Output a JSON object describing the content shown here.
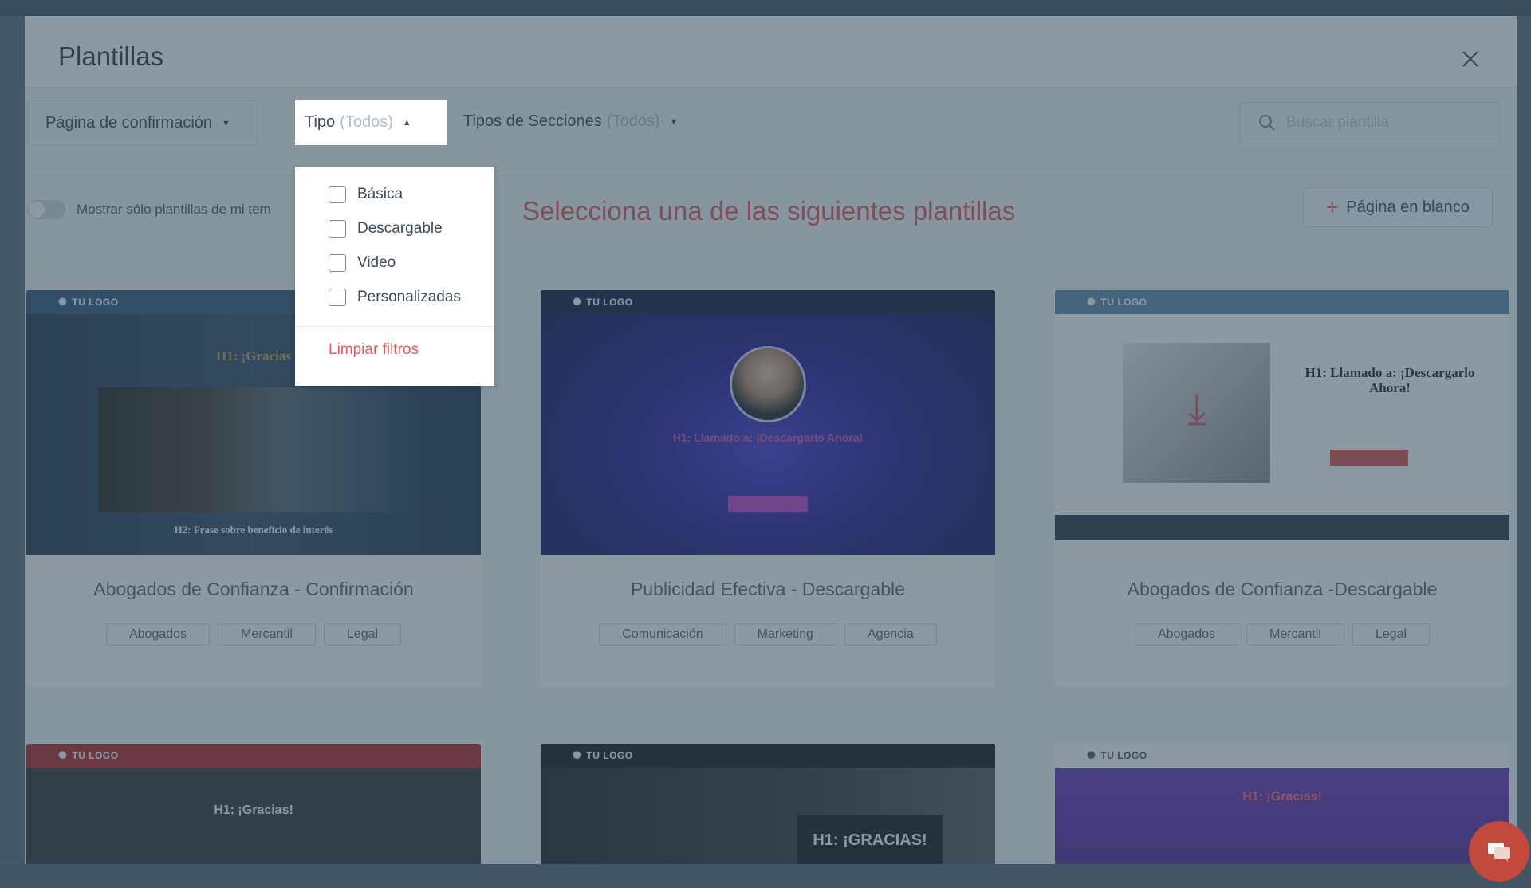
{
  "modal": {
    "title": "Plantillas"
  },
  "filters": {
    "page_type": "Página de confirmación",
    "tipo_label": "Tipo",
    "tipo_value": "(Todos)",
    "secciones_label": "Tipos de Secciones",
    "secciones_value": "(Todos)",
    "search_placeholder": "Buscar plantilla"
  },
  "toggle": {
    "label": "Mostrar sólo plantillas de mi tem"
  },
  "headline": "Selecciona una de las siguientes plantillas",
  "blank_page_button": "Página en blanco",
  "dropdown": {
    "options": [
      "Básica",
      "Descargable",
      "Video",
      "Personalizadas"
    ],
    "clear": "Limpiar filtros"
  },
  "cards": [
    {
      "title": "Abogados de Confianza - Confirmación",
      "tags": [
        "Abogados",
        "Mercantil",
        "Legal"
      ],
      "thumb": {
        "logo": "TU LOGO",
        "h1": "H1: ¡Gracias",
        "h2": "H2: Frase sobre beneficio de interés"
      }
    },
    {
      "title": "Publicidad Efectiva - Descargable",
      "tags": [
        "Comunicación",
        "Marketing",
        "Agencia"
      ],
      "thumb": {
        "logo": "TU LOGO",
        "h1": "H1: Llamado a: ¡Descargarlo Ahora!"
      }
    },
    {
      "title": "Abogados de Confianza -Descargable",
      "tags": [
        "Abogados",
        "Mercantil",
        "Legal"
      ],
      "thumb": {
        "logo": "TU LOGO",
        "h1": "H1: Llamado a: ¡Descargarlo Ahora!"
      }
    },
    {
      "thumb": {
        "logo": "TU LOGO",
        "h1": "H1: ¡Gracias!"
      }
    },
    {
      "thumb": {
        "logo": "TU LOGO",
        "h1": "H1: ¡GRACIAS!"
      }
    },
    {
      "thumb": {
        "logo": "TU LOGO",
        "h1": "H1: ¡Gracias!"
      }
    }
  ],
  "colors": {
    "accent": "#e25b5b",
    "overlay": "#2d4658"
  },
  "icons": {
    "close": "close-icon",
    "search": "search-icon",
    "plus": "plus-icon",
    "chat": "chat-icon",
    "caret_down": "caret-down-icon",
    "caret_up": "caret-up-icon"
  }
}
